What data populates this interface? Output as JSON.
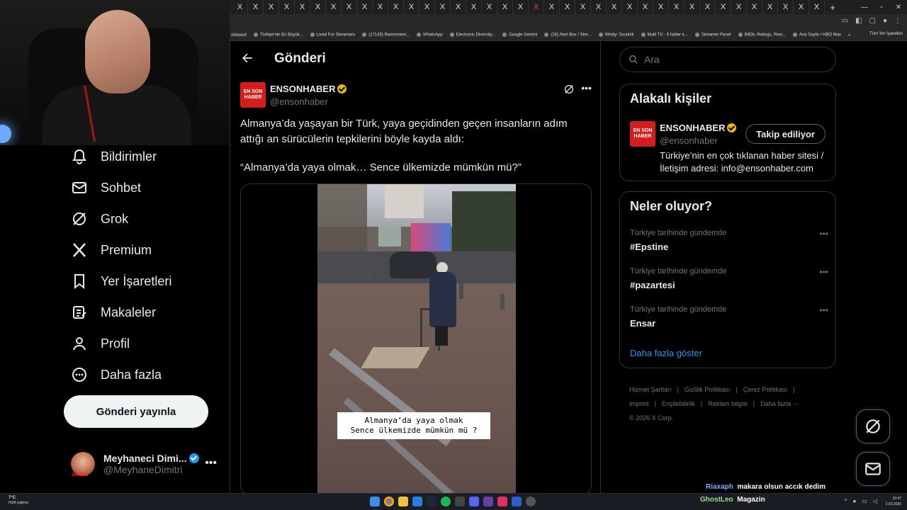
{
  "browser": {
    "tab_glyph": "X",
    "new_tab": "+",
    "bookmarks": [
      "shboard",
      "Türkiye'nin En Büyük...",
      "Livad For Streamers",
      "(17145) Rammstein...",
      "WhatsApp",
      "Electronic Diversity...",
      "Google Gemini",
      "(19) Alert Box / Stre...",
      "Windy: Sıcaklık",
      "Multi TV - 6 haber k...",
      "Streamer Panel",
      "IMDb: Ratings, Revi...",
      "Ana Sayfa • HBO Max"
    ],
    "bookmarks_overflow": "»",
    "bookmarks_all": "Tüm Yer İşaretleri"
  },
  "nav": {
    "items": [
      {
        "label": "Bildirimler",
        "icon": "bell-icon"
      },
      {
        "label": "Sohbet",
        "icon": "mail-icon"
      },
      {
        "label": "Grok",
        "icon": "grok-icon"
      },
      {
        "label": "Premium",
        "icon": "x-logo-icon"
      },
      {
        "label": "Yer İşaretleri",
        "icon": "bookmark-icon"
      },
      {
        "label": "Makaleler",
        "icon": "article-icon"
      },
      {
        "label": "Profil",
        "icon": "person-icon"
      },
      {
        "label": "Daha fazla",
        "icon": "more-circle-icon"
      }
    ],
    "post_button": "Gönderi yayınla",
    "account": {
      "name": "Meyhaneci Dimi...",
      "handle": "@MeyhaneDimitri",
      "avatar_text": "DİMİTRİ",
      "more": "•••"
    }
  },
  "main": {
    "title": "Gönderi",
    "post": {
      "logo_text": "EN SON HABER",
      "author": "ENSONHABER",
      "handle": "@ensonhaber",
      "more": "•••",
      "text1": "Almanya’da yaşayan bir Türk, yaya geçidinden geçen insanların adım attığı an sürücülerin tepkilerini böyle kayda aldı:",
      "text2": "“Almanya’da yaya olmak… Sence ülkemizde mümkün mü?”",
      "caption_line1": "Almanya’da yaya olmak",
      "caption_line2": "Sence ülkemizde mümkün mü ?"
    }
  },
  "right": {
    "search_placeholder": "Ara",
    "related": {
      "title": "Alakalı kişiler",
      "logo_text": "EN SON HABER",
      "name": "ENSONHABER",
      "handle": "@ensonhaber",
      "follow": "Takip ediliyor",
      "bio": "Türkiye’nin en çok tıklanan haber sitesi / İletişim adresi: info@ensonhaber.com"
    },
    "trends": {
      "title": "Neler oluyor?",
      "items": [
        {
          "context": "Türkiye tarihinde gündemde",
          "name": "#Epstine"
        },
        {
          "context": "Türkiye tarihinde gündemde",
          "name": "#pazartesi"
        },
        {
          "context": "Türkiye tarihinde gündemde",
          "name": "Ensar"
        }
      ],
      "more_glyph": "•••",
      "show_more": "Daha fazla göster"
    },
    "footer": [
      "Hizmet Şartları",
      "|",
      "Gizlilik Politikası",
      "|",
      "Çerez Politikası",
      "|",
      "Imprint",
      "|",
      "Erişilebilirlik",
      "|",
      "Reklam bilgisi",
      "|",
      "Daha fazla ···",
      "© 2026 X Corp."
    ]
  },
  "chat": [
    {
      "user": "Riaxaph",
      "message": "makara olsun accık dedim",
      "user_color": "#7ab0ff"
    },
    {
      "user": "GhostLeo",
      "message": "Magazin",
      "user_color": "#8fe08f"
    }
  ],
  "taskbar": {
    "temp": "7°C",
    "weather": "Hafif yağmur",
    "time": "10:47",
    "date": "2.02.2026"
  },
  "colors": {
    "accent": "#1d9bf0",
    "verified_gold": "#e2b719",
    "ensonhaber_red": "#d41e1e"
  }
}
